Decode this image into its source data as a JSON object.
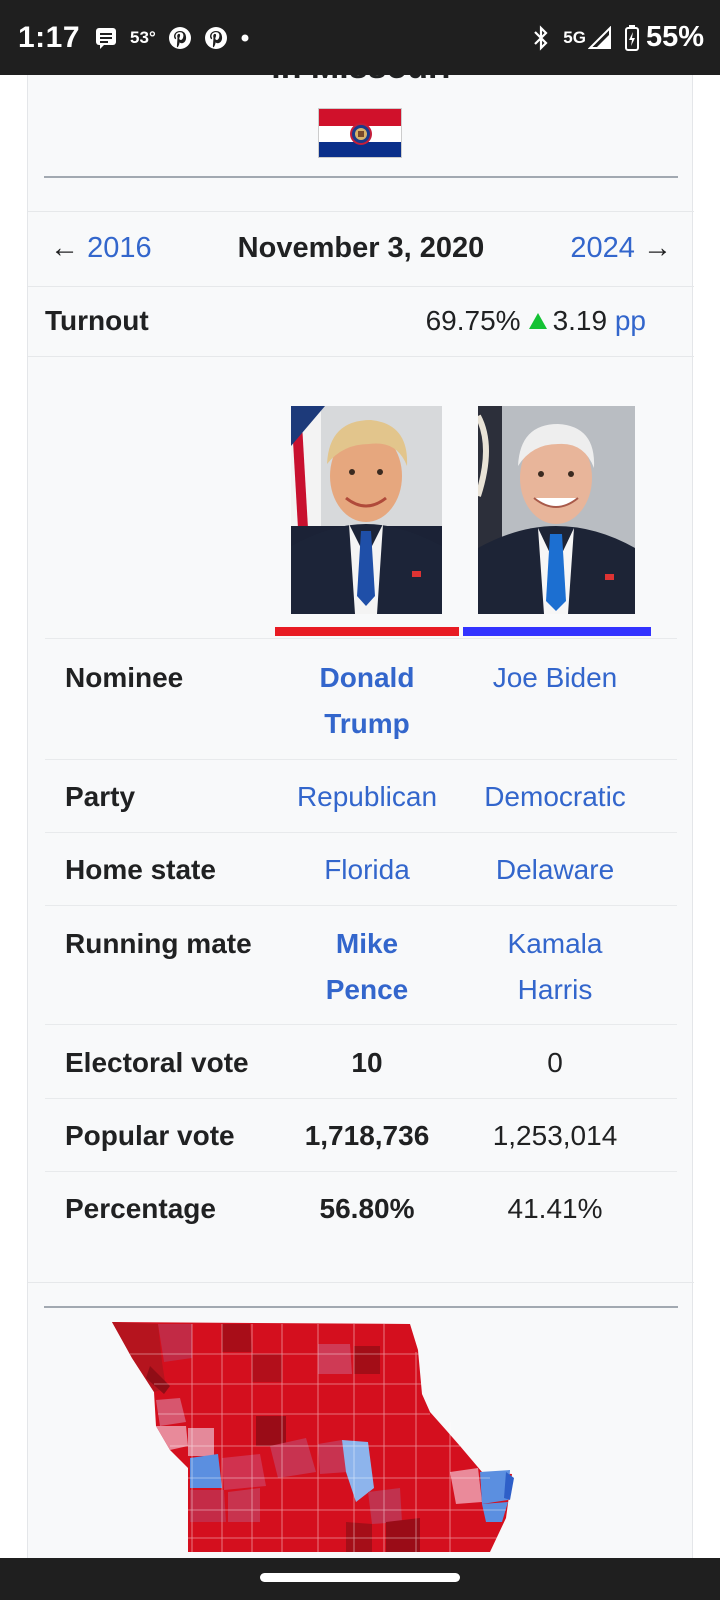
{
  "status_bar": {
    "time": "1:17",
    "temperature": "53°",
    "network": "5G",
    "battery": "55%",
    "icons": [
      "message-icon",
      "pinterest-icon",
      "pinterest-icon",
      "dot-icon",
      "bluetooth-icon",
      "signal-icon",
      "battery-icon"
    ]
  },
  "infobox": {
    "title": "in Missouri",
    "nav": {
      "prev_arrow": "←",
      "prev_year": "2016",
      "date": "November 3, 2020",
      "next_year": "2024",
      "next_arrow": "→"
    },
    "turnout": {
      "label": "Turnout",
      "value": "69.75%",
      "change": "3.19",
      "unit": "pp"
    },
    "candidates": [
      {
        "name": "Donald Trump",
        "name_line1": "Donald",
        "name_line2": "Trump",
        "party": "Republican",
        "home_state": "Florida",
        "running_mate_line1": "Mike",
        "running_mate_line2": "Pence",
        "electoral_vote": "10",
        "popular_vote": "1,718,736",
        "percentage": "56.80%",
        "color": "#e81b23",
        "winner": true
      },
      {
        "name": "Joe Biden",
        "party": "Democratic",
        "home_state": "Delaware",
        "running_mate_line1": "Kamala",
        "running_mate_line2": "Harris",
        "electoral_vote": "0",
        "popular_vote": "1,253,014",
        "percentage": "41.41%",
        "color": "#3333ff",
        "winner": false
      }
    ],
    "rows": {
      "nominee": "Nominee",
      "party": "Party",
      "home_state": "Home state",
      "running_mate": "Running mate",
      "electoral_vote": "Electoral vote",
      "popular_vote": "Popular vote",
      "percentage": "Percentage"
    }
  },
  "colors": {
    "link": "#3366cc",
    "republican": "#e81b23",
    "democratic": "#3333ff",
    "increase": "#14c234"
  }
}
